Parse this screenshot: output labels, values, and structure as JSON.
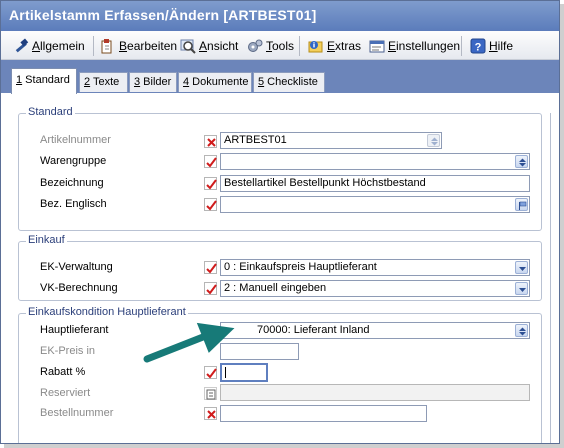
{
  "window": {
    "title": "Artikelstamm Erfassen/Ändern [ARTBEST01]"
  },
  "toolbar": {
    "items": [
      {
        "label": "Allgemein",
        "icon": "hammer-icon"
      },
      {
        "label": "Bearbeiten",
        "icon": "edit-icon"
      },
      {
        "label": "Ansicht",
        "icon": "magnifier-icon"
      },
      {
        "label": "Tools",
        "icon": "gears-icon"
      },
      {
        "label": "Extras",
        "icon": "info-folder-icon"
      },
      {
        "label": "Einstellungen",
        "icon": "settings-window-icon"
      },
      {
        "label": "Hilfe",
        "icon": "help-icon"
      }
    ]
  },
  "tabs": [
    {
      "num": "1",
      "label": " Standard"
    },
    {
      "num": "2",
      "label": " Texte"
    },
    {
      "num": "3",
      "label": " Bilder"
    },
    {
      "num": "4",
      "label": " Dokumente"
    },
    {
      "num": "5",
      "label": " Checkliste"
    }
  ],
  "groups": {
    "standard": {
      "title": "Standard",
      "artikelnummer": {
        "label": "Artikelnummer",
        "value": "ARTBEST01"
      },
      "warengruppe": {
        "label": "Warengruppe",
        "value": ""
      },
      "bezeichnung": {
        "label": "Bezeichnung",
        "value": "Bestellartikel Bestellpunkt Höchstbestand"
      },
      "bez_englisch": {
        "label": "Bez. Englisch",
        "value": ""
      }
    },
    "einkauf": {
      "title": "Einkauf",
      "ek_verwaltung": {
        "label": "EK-Verwaltung",
        "value": "0 : Einkaufspreis Hauptlieferant"
      },
      "vk_berechnung": {
        "label": "VK-Berechnung",
        "value": "2 : Manuell eingeben"
      }
    },
    "kondition": {
      "title": "Einkaufskondition Hauptlieferant",
      "hauptlieferant": {
        "label": "Hauptlieferant",
        "value": "70000: Lieferant Inland"
      },
      "ek_preis": {
        "label": "EK-Preis in",
        "value": ""
      },
      "rabatt": {
        "label": "Rabatt %",
        "value": ""
      },
      "reserviert": {
        "label": "Reserviert",
        "value": ""
      },
      "bestellnummer": {
        "label": "Bestellnummer",
        "value": ""
      }
    }
  },
  "colors": {
    "accent": "#6c85ba",
    "flag_red": "#d01c1c",
    "arrow": "#177a78"
  }
}
